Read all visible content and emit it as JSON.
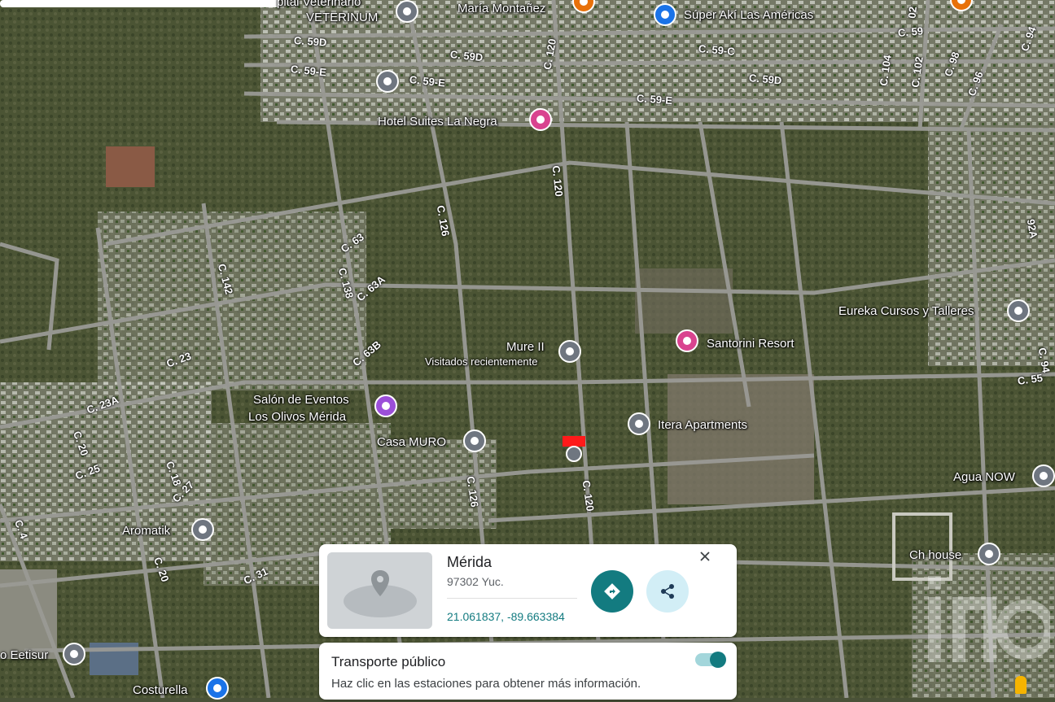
{
  "map": {
    "places": [
      {
        "id": "veterinario",
        "line1": "pital Veterinario",
        "line2": "VETERINUM"
      },
      {
        "id": "maria",
        "line1": "María Montañez"
      },
      {
        "id": "super",
        "line1": "Súper Akí Las Américas"
      },
      {
        "id": "hotel",
        "line1": "Hotel Suites La Negra"
      },
      {
        "id": "eureka",
        "line1": "Eureka Cursos y Talleres"
      },
      {
        "id": "mure",
        "line1": "Mure II",
        "line2": "Visitados recientemente"
      },
      {
        "id": "santorini",
        "line1": "Santorini Resort"
      },
      {
        "id": "salon",
        "line1": "Salón de Eventos",
        "line2": "Los Olivos Mérida"
      },
      {
        "id": "itera",
        "line1": "Itera Apartments"
      },
      {
        "id": "casamuro",
        "line1": "Casa MURO"
      },
      {
        "id": "agua",
        "line1": "Agua NOW"
      },
      {
        "id": "aromatik",
        "line1": "Aromatik"
      },
      {
        "id": "chhouse",
        "line1": "Ch house"
      },
      {
        "id": "eetisur",
        "line1": "o Eetisur"
      },
      {
        "id": "costurella",
        "line1": "Costurella"
      }
    ],
    "streets": [
      "C. 59D",
      "C. 59-E",
      "C. 59D",
      "C. 59-E",
      "C. 120",
      "C. 59-C",
      "C. 59D",
      "C. 59-E",
      "C. 59",
      "C. 104",
      "C. 102",
      "C. 98",
      "C. 96",
      "C. 94",
      "02",
      "C. 120",
      "C. 126",
      "C. 63",
      "C. 138",
      "C. 63A",
      "C. 142",
      "C. 63B",
      "C. 23",
      "C. 23A",
      "C. 20",
      "C. 25",
      "C. 18",
      "C. 27",
      "C. 4",
      "C. 20",
      "C. 31",
      "C. 126",
      "C. 120",
      "C. 55",
      "92A",
      "C. 94"
    ]
  },
  "info_card": {
    "title": "Mérida",
    "subtitle": "97302 Yuc.",
    "coordinates": "21.061837, -89.663384",
    "close_icon": "close-icon",
    "directions_icon": "directions-icon",
    "share_icon": "share-icon",
    "thumbnail_icon": "location-pin-icon"
  },
  "transit_card": {
    "title": "Transporte público",
    "description": "Haz clic en las estaciones para obtener más información.",
    "toggle_on": true
  },
  "colors": {
    "accent_teal": "#137b80",
    "share_bg": "#d2eef6",
    "pin_gray": "#6f7680",
    "pin_pink": "#d9438f",
    "pin_purple": "#9c4fd9",
    "pin_blue": "#1a73e8",
    "pin_orange": "#e8710a",
    "marker_red": "#ff1a1a"
  }
}
